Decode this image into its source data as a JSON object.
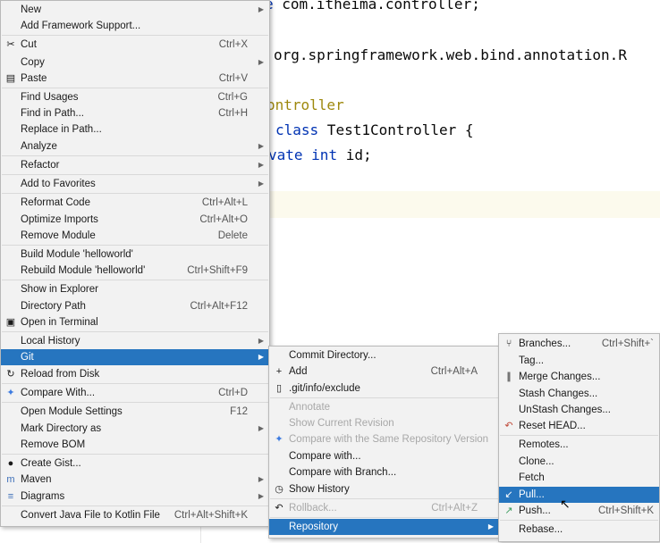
{
  "editor": {
    "line1_kw": "e",
    "line1_text": " com.itheima.controller;",
    "line2_text": "org.springframework.web.bind.annotation.R",
    "line3_ann": "ontroller",
    "line4_kw": "class",
    "line4_text": " Test1Controller {",
    "line5_kw1": "vate",
    "line5_kw2": "int",
    "line5_text": " id;"
  },
  "context_menu": {
    "items": [
      {
        "label": "New",
        "shortcut": "",
        "icon": ""
      },
      {
        "label": "Add Framework Support...",
        "shortcut": "",
        "icon": ""
      },
      {
        "label": "Cut",
        "shortcut": "Ctrl+X",
        "icon": "scissors-icon"
      },
      {
        "label": "Copy",
        "shortcut": "",
        "icon": ""
      },
      {
        "label": "Paste",
        "shortcut": "Ctrl+V",
        "icon": "clipboard-icon"
      },
      {
        "label": "Find Usages",
        "shortcut": "Ctrl+G",
        "icon": ""
      },
      {
        "label": "Find in Path...",
        "shortcut": "Ctrl+H",
        "icon": ""
      },
      {
        "label": "Replace in Path...",
        "shortcut": "",
        "icon": ""
      },
      {
        "label": "Analyze",
        "shortcut": "",
        "icon": ""
      },
      {
        "label": "Refactor",
        "shortcut": "",
        "icon": ""
      },
      {
        "label": "Add to Favorites",
        "shortcut": "",
        "icon": ""
      },
      {
        "label": "Reformat Code",
        "shortcut": "Ctrl+Alt+L",
        "icon": ""
      },
      {
        "label": "Optimize Imports",
        "shortcut": "Ctrl+Alt+O",
        "icon": ""
      },
      {
        "label": "Remove Module",
        "shortcut": "Delete",
        "icon": ""
      },
      {
        "label": "Build Module 'helloworld'",
        "shortcut": "",
        "icon": ""
      },
      {
        "label": "Rebuild Module 'helloworld'",
        "shortcut": "Ctrl+Shift+F9",
        "icon": ""
      },
      {
        "label": "Show in Explorer",
        "shortcut": "",
        "icon": ""
      },
      {
        "label": "Directory Path",
        "shortcut": "Ctrl+Alt+F12",
        "icon": ""
      },
      {
        "label": "Open in Terminal",
        "shortcut": "",
        "icon": "terminal-icon"
      },
      {
        "label": "Local History",
        "shortcut": "",
        "icon": ""
      },
      {
        "label": "Git",
        "shortcut": "",
        "icon": ""
      },
      {
        "label": "Reload from Disk",
        "shortcut": "",
        "icon": "reload-icon"
      },
      {
        "label": "Compare With...",
        "shortcut": "Ctrl+D",
        "icon": "compare-icon"
      },
      {
        "label": "Open Module Settings",
        "shortcut": "F12",
        "icon": ""
      },
      {
        "label": "Mark Directory as",
        "shortcut": "",
        "icon": ""
      },
      {
        "label": "Remove BOM",
        "shortcut": "",
        "icon": ""
      },
      {
        "label": "Create Gist...",
        "shortcut": "",
        "icon": "github-icon"
      },
      {
        "label": "Maven",
        "shortcut": "",
        "icon": "maven-icon"
      },
      {
        "label": "Diagrams",
        "shortcut": "",
        "icon": "diagram-icon"
      },
      {
        "label": "Convert Java File to Kotlin File",
        "shortcut": "Ctrl+Alt+Shift+K",
        "icon": ""
      }
    ]
  },
  "git_menu": {
    "items": [
      {
        "label": "Commit Directory...",
        "shortcut": "",
        "icon": ""
      },
      {
        "label": "Add",
        "shortcut": "Ctrl+Alt+A",
        "icon": "plus-icon"
      },
      {
        "label": ".git/info/exclude",
        "shortcut": "",
        "icon": "file-icon"
      },
      {
        "label": "Annotate",
        "shortcut": "",
        "icon": ""
      },
      {
        "label": "Show Current Revision",
        "shortcut": "",
        "icon": ""
      },
      {
        "label": "Compare with the Same Repository Version",
        "shortcut": "",
        "icon": "compare-icon"
      },
      {
        "label": "Compare with...",
        "shortcut": "",
        "icon": ""
      },
      {
        "label": "Compare with Branch...",
        "shortcut": "",
        "icon": ""
      },
      {
        "label": "Show History",
        "shortcut": "",
        "icon": "clock-icon"
      },
      {
        "label": "Rollback...",
        "shortcut": "Ctrl+Alt+Z",
        "icon": "undo-icon"
      },
      {
        "label": "Repository",
        "shortcut": "",
        "icon": ""
      }
    ]
  },
  "repository_menu": {
    "items": [
      {
        "label": "Branches...",
        "shortcut": "Ctrl+Shift+`",
        "icon": "branch-icon"
      },
      {
        "label": "Tag...",
        "shortcut": "",
        "icon": ""
      },
      {
        "label": "Merge Changes...",
        "shortcut": "",
        "icon": "merge-icon"
      },
      {
        "label": "Stash Changes...",
        "shortcut": "",
        "icon": ""
      },
      {
        "label": "UnStash Changes...",
        "shortcut": "",
        "icon": ""
      },
      {
        "label": "Reset HEAD...",
        "shortcut": "",
        "icon": "reset-icon"
      },
      {
        "label": "Remotes...",
        "shortcut": "",
        "icon": ""
      },
      {
        "label": "Clone...",
        "shortcut": "",
        "icon": ""
      },
      {
        "label": "Fetch",
        "shortcut": "",
        "icon": ""
      },
      {
        "label": "Pull...",
        "shortcut": "",
        "icon": "pull-icon"
      },
      {
        "label": "Push...",
        "shortcut": "Ctrl+Shift+K",
        "icon": "push-icon"
      },
      {
        "label": "Rebase...",
        "shortcut": "",
        "icon": ""
      }
    ]
  },
  "colors": {
    "selection": "#2675bf",
    "menu_bg": "#f2f2f2",
    "keyword": "#0033b3",
    "annotation": "#9e880d"
  }
}
